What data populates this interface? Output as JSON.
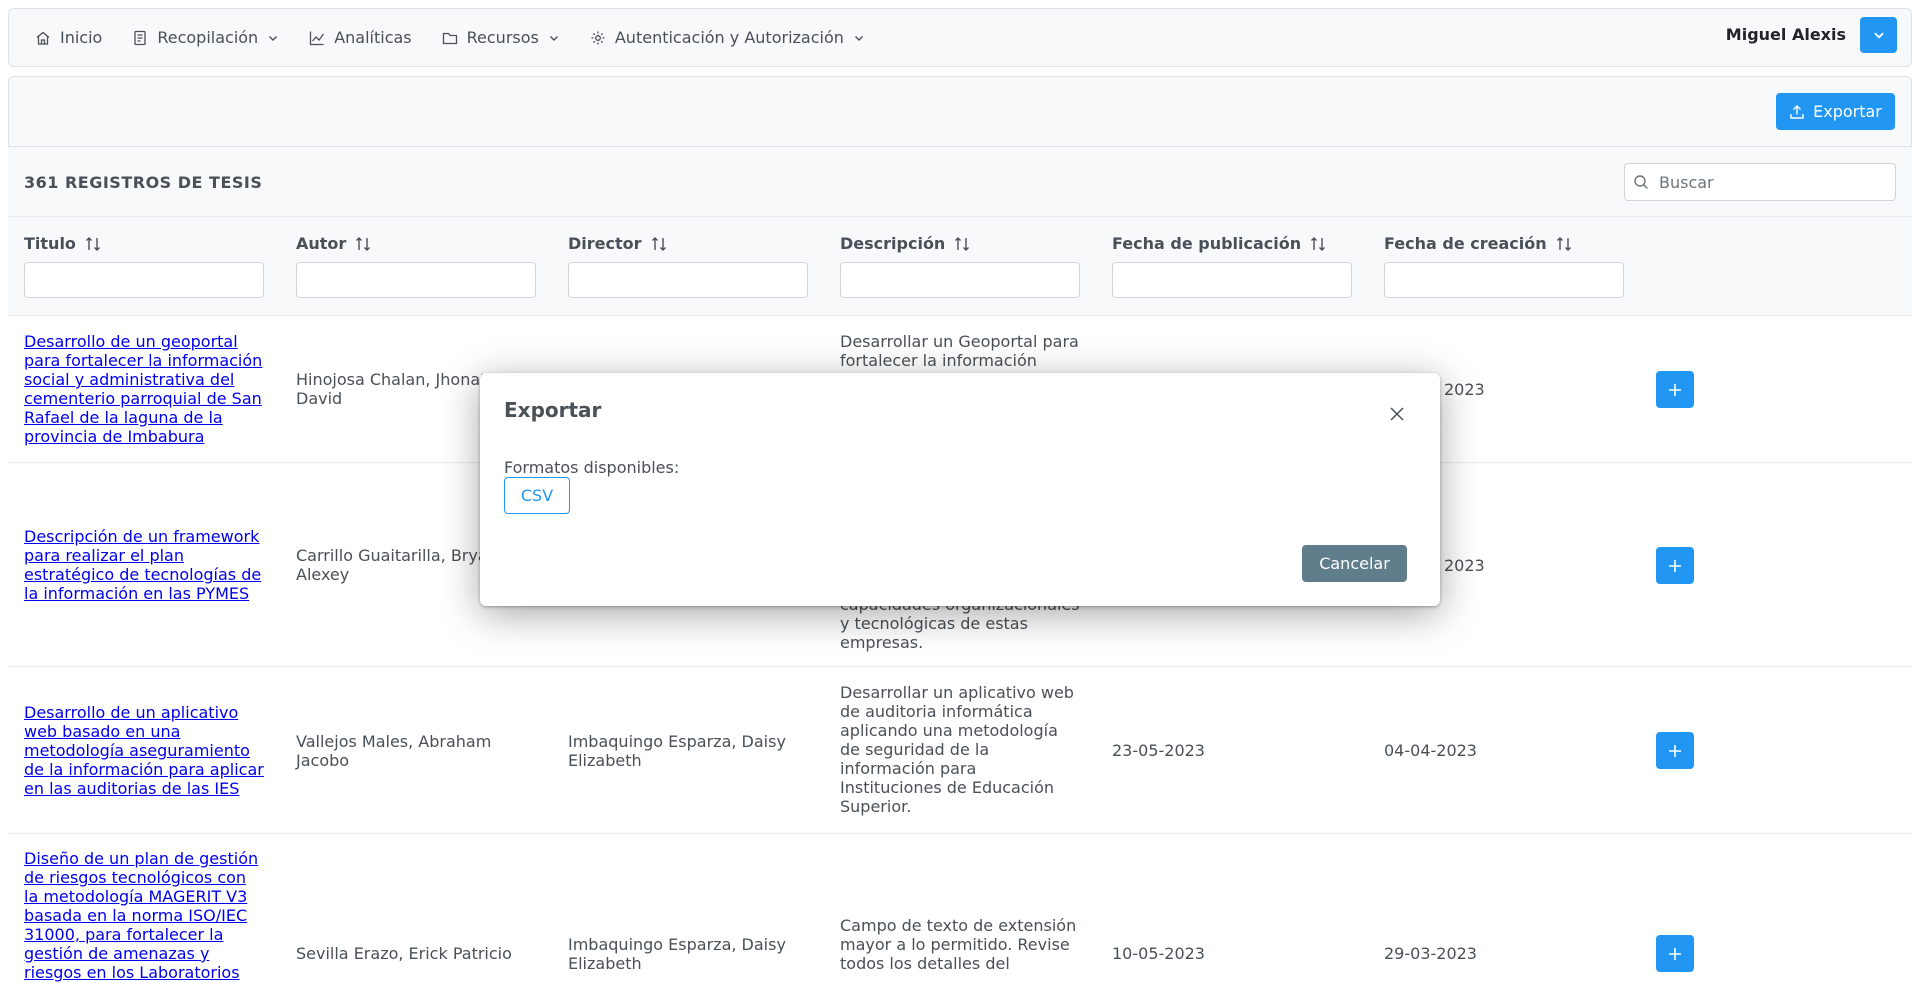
{
  "navbar": {
    "items": [
      {
        "label": "Inicio",
        "icon": "home-icon",
        "dropdown": false
      },
      {
        "label": "Recopilación",
        "icon": "document-icon",
        "dropdown": true
      },
      {
        "label": "Analíticas",
        "icon": "chart-line-icon",
        "dropdown": false
      },
      {
        "label": "Recursos",
        "icon": "folder-icon",
        "dropdown": true
      },
      {
        "label": "Autenticación y Autorización",
        "icon": "gear-icon",
        "dropdown": true
      }
    ],
    "user_name": "Miguel Alexis"
  },
  "toolbar": {
    "export_label": "Exportar"
  },
  "table": {
    "title": "361 REGISTROS DE TESIS",
    "search_placeholder": "Buscar",
    "columns": [
      "Titulo",
      "Autor",
      "Director",
      "Descripción",
      "Fecha de publicación",
      "Fecha de creación"
    ],
    "rows": [
      {
        "title": "Desarrollo de un geoportal para fortalecer la información social y administrativa del cementerio parroquial de San Rafael de la laguna de la provincia de Imbabura",
        "author": "Hinojosa Chalan, Jhonatan David",
        "director": "",
        "description": "Desarrollar un Geoportal para fortalecer la información",
        "publication_date": "",
        "creation_date": "2023"
      },
      {
        "title": "Descripción de un framework para realizar el plan estratégico de tecnologías de la información en las PYMES",
        "author": "Carrillo Guaitarilla, Bryan Alexey",
        "director": "",
        "description": "capacidades organizacionales y tecnológicas de estas empresas.",
        "publication_date": "",
        "creation_date": "2023"
      },
      {
        "title": "Desarrollo de un aplicativo web basado en una metodología aseguramiento de la información para aplicar en las auditorias de las IES",
        "author": "Vallejos Males, Abraham Jacobo",
        "director": "Imbaquingo Esparza, Daisy Elizabeth",
        "description": "Desarrollar un aplicativo web de auditoria informática aplicando una metodología de seguridad de la información para Instituciones de Educación Superior.",
        "publication_date": "23-05-2023",
        "creation_date": "04-04-2023"
      },
      {
        "title": "Diseño de un plan de gestión de riesgos tecnológicos con la metodología MAGERIT V3 basada en la norma ISO/IEC 31000, para fortalecer la gestión de amenazas y riesgos en los Laboratorios",
        "author": "Sevilla Erazo, Erick Patricio",
        "director": "Imbaquingo Esparza, Daisy Elizabeth",
        "description": "Campo de texto de extensión mayor a lo permitido. Revise todos los detalles del",
        "publication_date": "10-05-2023",
        "creation_date": "29-03-2023"
      }
    ]
  },
  "modal": {
    "title": "Exportar",
    "formats_label": "Formatos disponibles:",
    "format_csv": "CSV",
    "cancel_label": "Cancelar"
  },
  "colors": {
    "primary": "#2196f3",
    "secondary": "#607d8b",
    "link": "#0000ee"
  }
}
